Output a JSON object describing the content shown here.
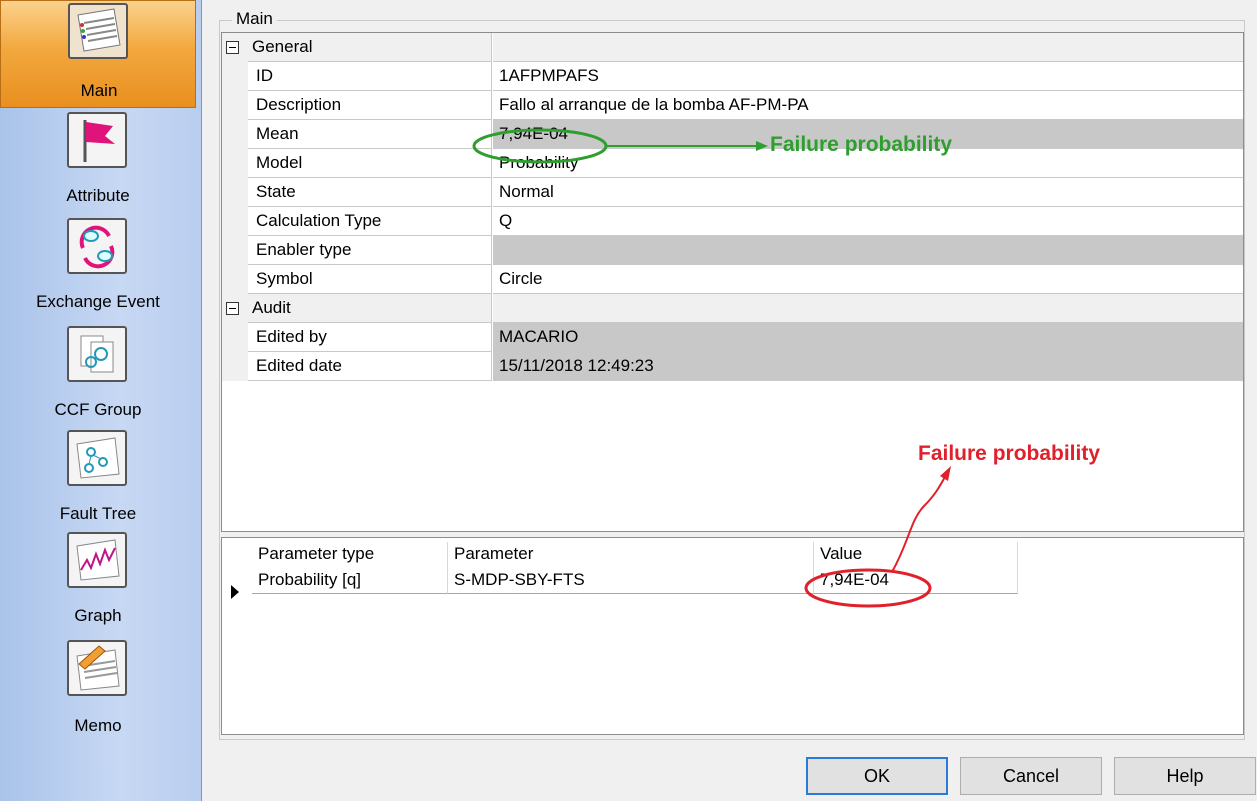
{
  "nav": {
    "items": [
      {
        "label": "Main",
        "icon": "main-doc-icon",
        "active": true
      },
      {
        "label": "Attribute",
        "icon": "flag-icon",
        "active": false
      },
      {
        "label": "Exchange Event",
        "icon": "exchange-cycle-icon",
        "active": false
      },
      {
        "label": "CCF Group",
        "icon": "ccf-group-icon",
        "active": false
      },
      {
        "label": "Fault Tree",
        "icon": "fault-tree-icon",
        "active": false
      },
      {
        "label": "Graph",
        "icon": "graph-icon",
        "active": false
      },
      {
        "label": "Memo",
        "icon": "memo-pencil-icon",
        "active": false
      }
    ]
  },
  "main": {
    "group_title": "Main",
    "properties": {
      "general": {
        "label": "General"
      },
      "id": {
        "label": "ID",
        "value": "1AFPMPAFS"
      },
      "description": {
        "label": "Description",
        "value": "Fallo al arranque de la bomba AF-PM-PA"
      },
      "mean": {
        "label": "Mean",
        "value": "7,94E-04"
      },
      "model": {
        "label": "Model",
        "value": "Probability"
      },
      "state": {
        "label": "State",
        "value": "Normal"
      },
      "calculation_type": {
        "label": "Calculation Type",
        "value": "Q"
      },
      "enabler_type": {
        "label": "Enabler type",
        "value": ""
      },
      "symbol": {
        "label": "Symbol",
        "value": "Circle"
      },
      "audit": {
        "label": "Audit"
      },
      "edited_by": {
        "label": "Edited by",
        "value": "MACARIO"
      },
      "edited_date": {
        "label": "Edited date",
        "value": "15/11/2018 12:49:23"
      }
    },
    "parameters": {
      "headers": {
        "type": "Parameter type",
        "parameter": "Parameter",
        "value": "Value"
      },
      "rows": [
        {
          "type": "Probability [q]",
          "parameter": "S-MDP-SBY-FTS",
          "value": "7,94E-04"
        }
      ]
    }
  },
  "buttons": {
    "ok": "OK",
    "cancel": "Cancel",
    "help": "Help"
  },
  "annotations": {
    "mean_label": "Failure probability",
    "value_label": "Failure probability",
    "green": "#2e9e2e",
    "red": "#e0202a"
  }
}
